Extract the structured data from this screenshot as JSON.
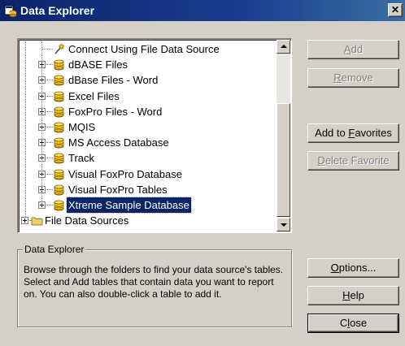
{
  "window": {
    "title": "Data Explorer",
    "close_glyph": "✕"
  },
  "tree": {
    "items": [
      {
        "label": "Connect Using File Data Source",
        "icon": "wand-icon",
        "expandable": false,
        "selected": false
      },
      {
        "label": "dBASE Files",
        "icon": "database-icon",
        "expandable": true,
        "selected": false
      },
      {
        "label": "dBase Files - Word",
        "icon": "database-icon",
        "expandable": true,
        "selected": false
      },
      {
        "label": "Excel Files",
        "icon": "database-icon",
        "expandable": true,
        "selected": false
      },
      {
        "label": "FoxPro Files - Word",
        "icon": "database-icon",
        "expandable": true,
        "selected": false
      },
      {
        "label": "MQIS",
        "icon": "database-icon",
        "expandable": true,
        "selected": false
      },
      {
        "label": "MS Access Database",
        "icon": "database-icon",
        "expandable": true,
        "selected": false
      },
      {
        "label": "Track",
        "icon": "database-icon",
        "expandable": true,
        "selected": false
      },
      {
        "label": "Visual FoxPro Database",
        "icon": "database-icon",
        "expandable": true,
        "selected": false
      },
      {
        "label": "Visual FoxPro Tables",
        "icon": "database-icon",
        "expandable": true,
        "selected": false
      },
      {
        "label": "Xtreme Sample Database",
        "icon": "database-icon",
        "expandable": true,
        "selected": true
      },
      {
        "label": "File Data Sources",
        "icon": "folder-icon",
        "expandable": true,
        "selected": false
      }
    ]
  },
  "buttons": {
    "add": {
      "label": "Add",
      "mnemonic": "A",
      "enabled": false
    },
    "remove": {
      "label": "Remove",
      "mnemonic": "R",
      "enabled": false
    },
    "add_favorites": {
      "label": "Add to Favorites",
      "mnemonic": "F",
      "enabled": true
    },
    "delete_favorite": {
      "label": "Delete Favorite",
      "mnemonic": "D",
      "enabled": false
    },
    "options": {
      "label": "Options...",
      "mnemonic": "O",
      "enabled": true
    },
    "help": {
      "label": "Help",
      "mnemonic": "H",
      "enabled": true
    },
    "close": {
      "label": "Close",
      "mnemonic": "l",
      "enabled": true
    }
  },
  "groupbox": {
    "legend": "Data Explorer",
    "description": "Browse through the folders to find your data source's tables.  Select and Add tables that contain data you want to report on.  You can also double-click a table to add it."
  },
  "colors": {
    "titlebar": "#0a246a",
    "face": "#d4d0c8",
    "selection": "#0a246a",
    "db_icon": "#f0c020"
  }
}
